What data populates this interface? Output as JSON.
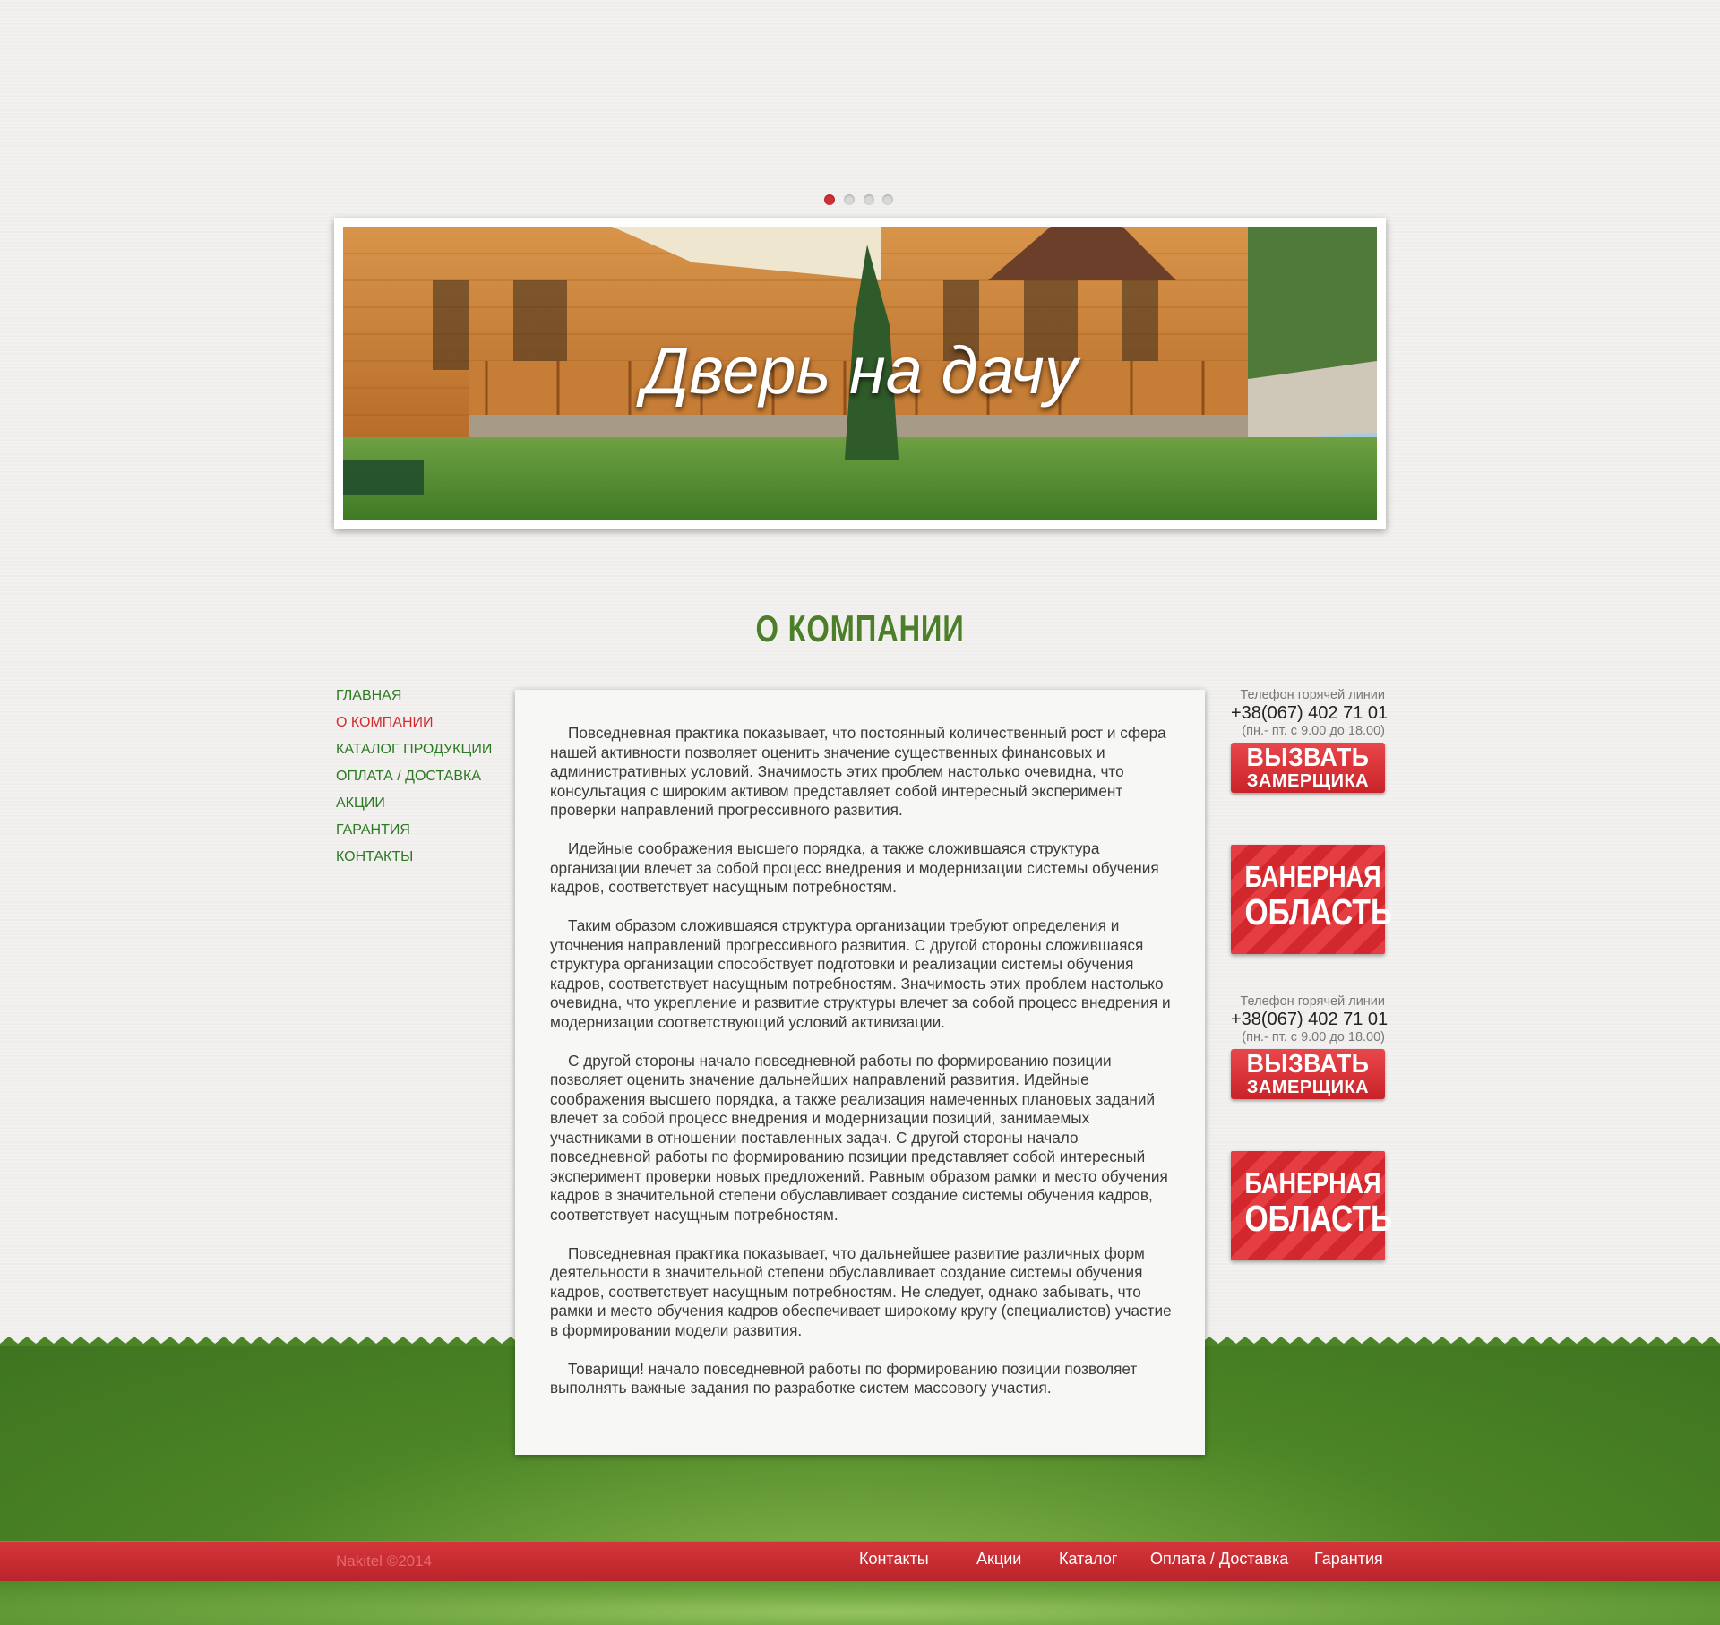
{
  "slider": {
    "dots": 4,
    "active_index": 0
  },
  "banner": {
    "title": "Дверь на дачу"
  },
  "section": {
    "title": "О КОМПАНИИ"
  },
  "nav": {
    "items": [
      {
        "label": "ГЛАВНАЯ"
      },
      {
        "label": "О КОМПАНИИ",
        "active": true
      },
      {
        "label": "КАТАЛОГ ПРОДУКЦИИ"
      },
      {
        "label": "ОПЛАТА / ДОСТАВКА"
      },
      {
        "label": "АКЦИИ"
      },
      {
        "label": "ГАРАНТИЯ"
      },
      {
        "label": "КОНТАКТЫ"
      }
    ]
  },
  "content": {
    "paragraphs": [
      "Повседневная практика показывает, что постоянный количественный рост и сфера нашей активности позволяет оценить значение существенных финансовых и административных условий. Значимость этих проблем настолько очевидна, что консультация с широким активом представляет собой интересный эксперимент проверки направлений прогрессивного развития.",
      "Идейные соображения высшего порядка, а также сложившаяся структура организации влечет за собой процесс внедрения и модернизации системы обучения кадров, соответствует насущным потребностям.",
      "Таким образом сложившаяся структура организации требуют определения и уточнения направлений прогрессивного развития. С другой стороны сложившаяся структура организации способствует подготовки и реализации системы обучения кадров, соответствует насущным потребностям. Значимость этих проблем настолько очевидна, что укрепление и развитие структуры влечет за собой процесс внедрения и модернизации соответствующий условий активизации.",
      "С другой стороны начало повседневной работы по формированию позиции позволяет оценить значение дальнейших направлений развития. Идейные соображения высшего порядка, а также реализация намеченных плановых заданий влечет за собой процесс внедрения и модернизации позиций, занимаемых участниками в отношении поставленных задач. С другой стороны начало повседневной работы по формированию позиции представляет собой интересный эксперимент проверки новых предложений. Равным образом рамки и место обучения кадров в значительной степени обуславливает создание системы обучения кадров, соответствует насущным потребностям.",
      "Повседневная практика показывает, что дальнейшее развитие различных форм деятельности в значительной степени обуславливает создание системы обучения кадров, соответствует насущным потребностям. Не следует, однако забывать, что рамки и место обучения кадров обеспечивает широкому кругу (специалистов) участие в формировании модели развития.",
      "Товарищи! начало повседневной работы по формированию позиции позволяет выполнять важные задания по разработке систем массовогу участия."
    ]
  },
  "sidebar": {
    "hotline_1": {
      "label": "Телефон горячей линии",
      "phone": "+38(067) 402 71 01",
      "hours": "(пн.- пт. с 9.00 до 18.00)"
    },
    "call_btn_1": {
      "line1": "ВЫЗВАТЬ",
      "line2": "ЗАМЕРЩИКА"
    },
    "banner_1": {
      "line1": "БАНЕРНАЯ",
      "line2": "ОБЛАСТЬ"
    },
    "hotline_2": {
      "label": "Телефон горячей линии",
      "phone": "+38(067) 402 71 01",
      "hours": "(пн.- пт. с 9.00 до 18.00)"
    },
    "call_btn_2": {
      "line1": "ВЫЗВАТЬ",
      "line2": "ЗАМЕРЩИКА"
    },
    "banner_2": {
      "line1": "БАНЕРНАЯ",
      "line2": "ОБЛАСТЬ"
    }
  },
  "footer": {
    "copyright": "Nakitel ©2014",
    "links": [
      "Контакты",
      "Акции",
      "Каталог",
      "Оплата / Доставка",
      "Гарантия"
    ]
  },
  "colors": {
    "accent_red": "#d22f34",
    "nav_green": "#2c7a22",
    "title_green": "#4d7f2b",
    "footer_green": "#4c8526"
  }
}
